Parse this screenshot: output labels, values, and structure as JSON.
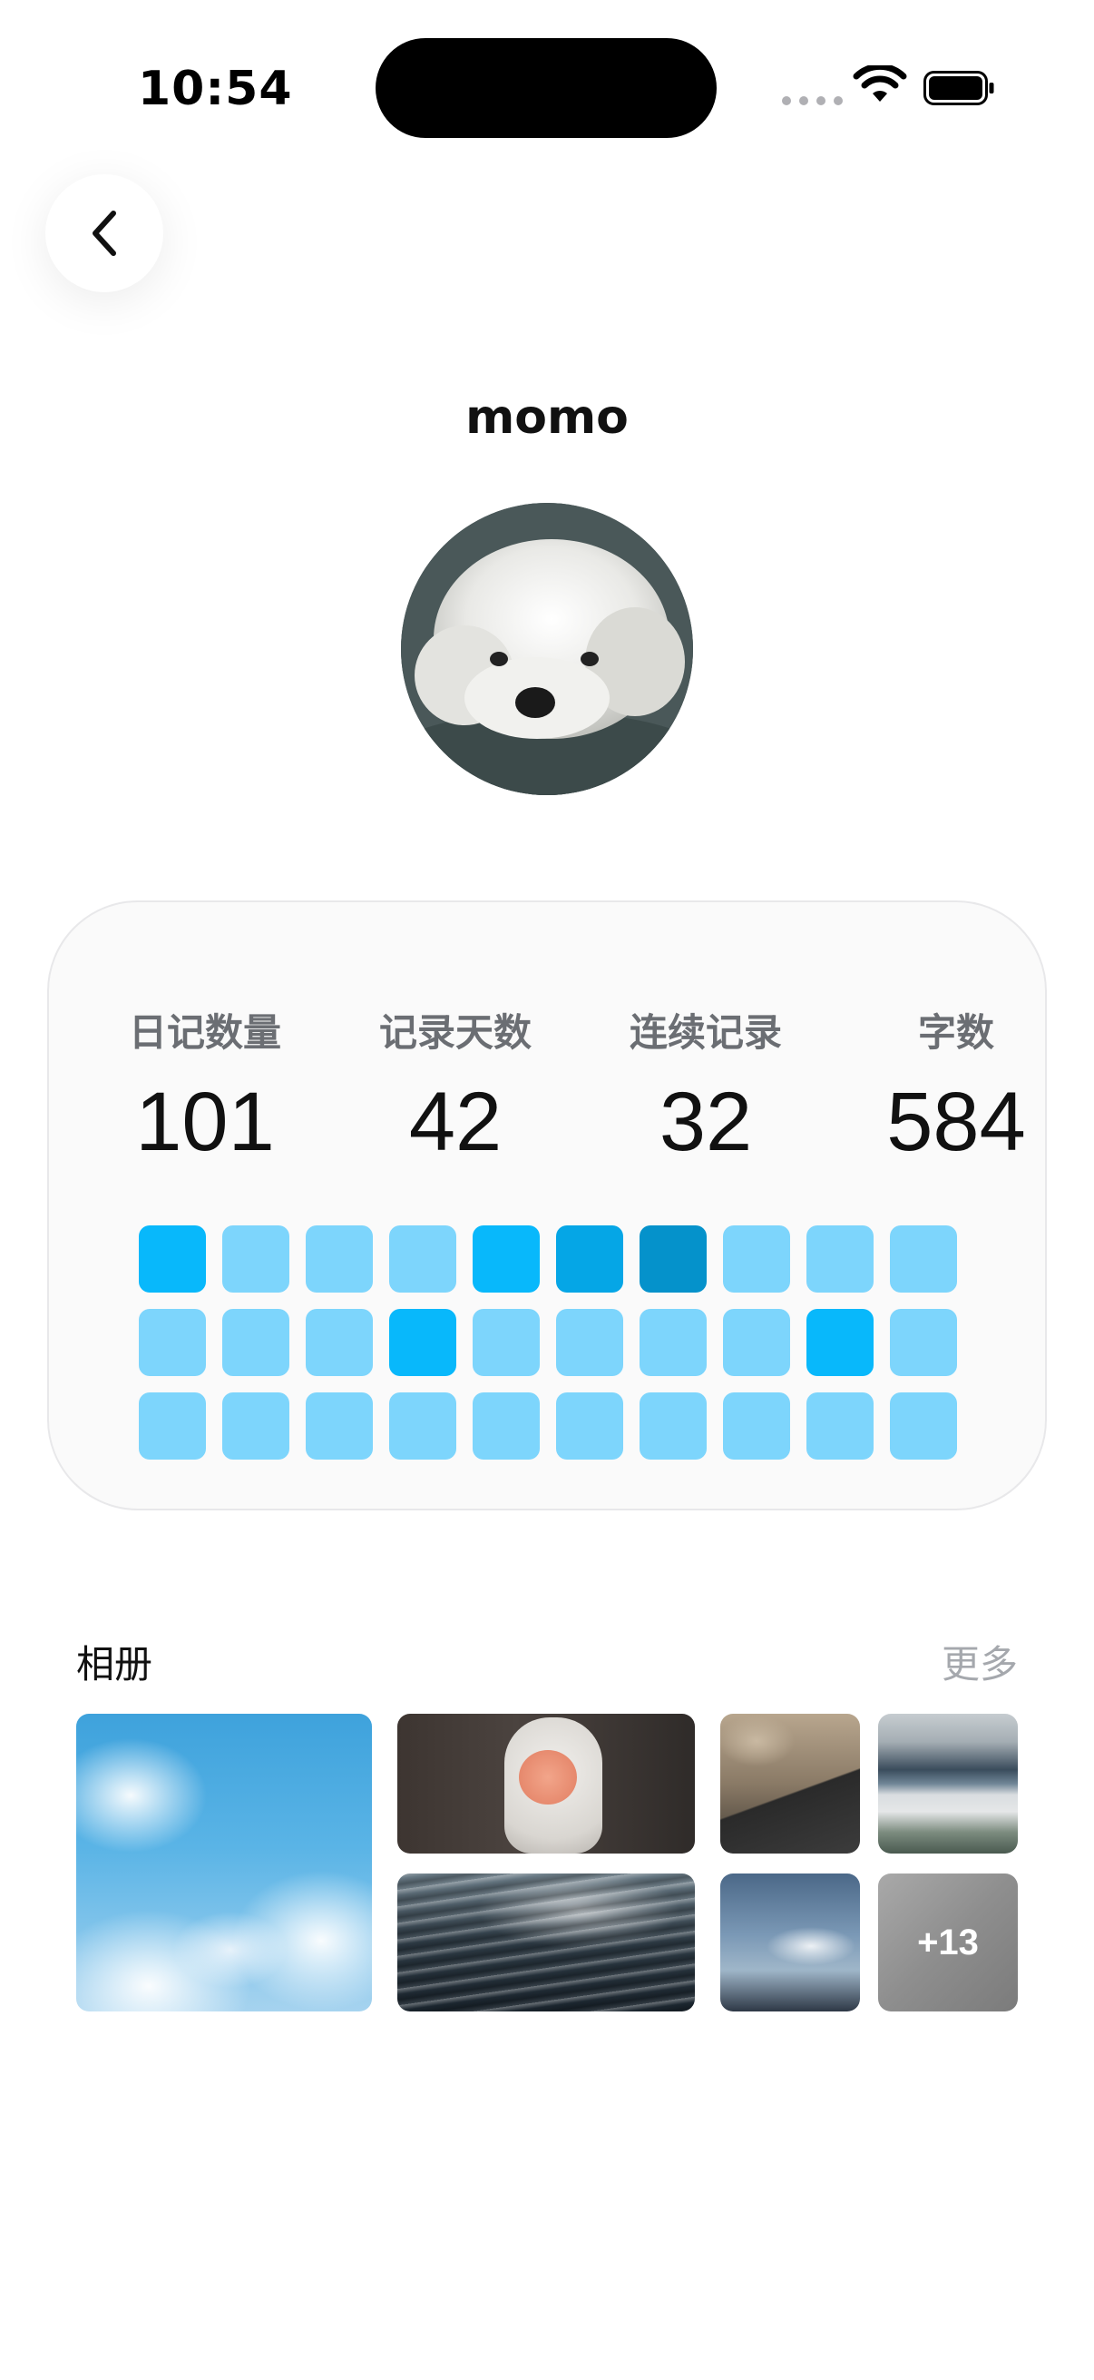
{
  "status_bar": {
    "time": "10:54"
  },
  "header": {
    "title": "momo",
    "back_icon": "chevron-left-icon"
  },
  "avatar": {
    "subject": "white fluffy puppy"
  },
  "stats": [
    {
      "label": "日记数量",
      "value": "101"
    },
    {
      "label": "记录天数",
      "value": "42"
    },
    {
      "label": "连续记录",
      "value": "32"
    },
    {
      "label": "字数",
      "value": "584"
    }
  ],
  "activity_grid": {
    "rows": [
      [
        3,
        1,
        1,
        1,
        3,
        4,
        5,
        1,
        1,
        1
      ],
      [
        1,
        1,
        1,
        3,
        1,
        1,
        1,
        1,
        3,
        1
      ],
      [
        1,
        1,
        1,
        1,
        1,
        1,
        1,
        1,
        1,
        1
      ]
    ],
    "levels": {
      "1": "#7dd5fc",
      "3": "#08b8fb",
      "4": "#05a6e6",
      "5": "#0592cb"
    }
  },
  "album": {
    "title": "相册",
    "more": "更多",
    "photos": [
      {
        "subject": "clouds in blue sky"
      },
      {
        "subject": "plush toy with peach face"
      },
      {
        "subject": "shimmering water surface"
      },
      {
        "subject": "outdoor laptop scene"
      },
      {
        "subject": "misty lake and sky"
      },
      {
        "subject": "sunlit cloud over hills"
      }
    ],
    "overflow_count": "+13"
  },
  "colors": {
    "accent": "#08b8fb",
    "card_bg": "#fafafa",
    "muted_text": "#6b6e73",
    "more_text": "#a5a8ad"
  }
}
